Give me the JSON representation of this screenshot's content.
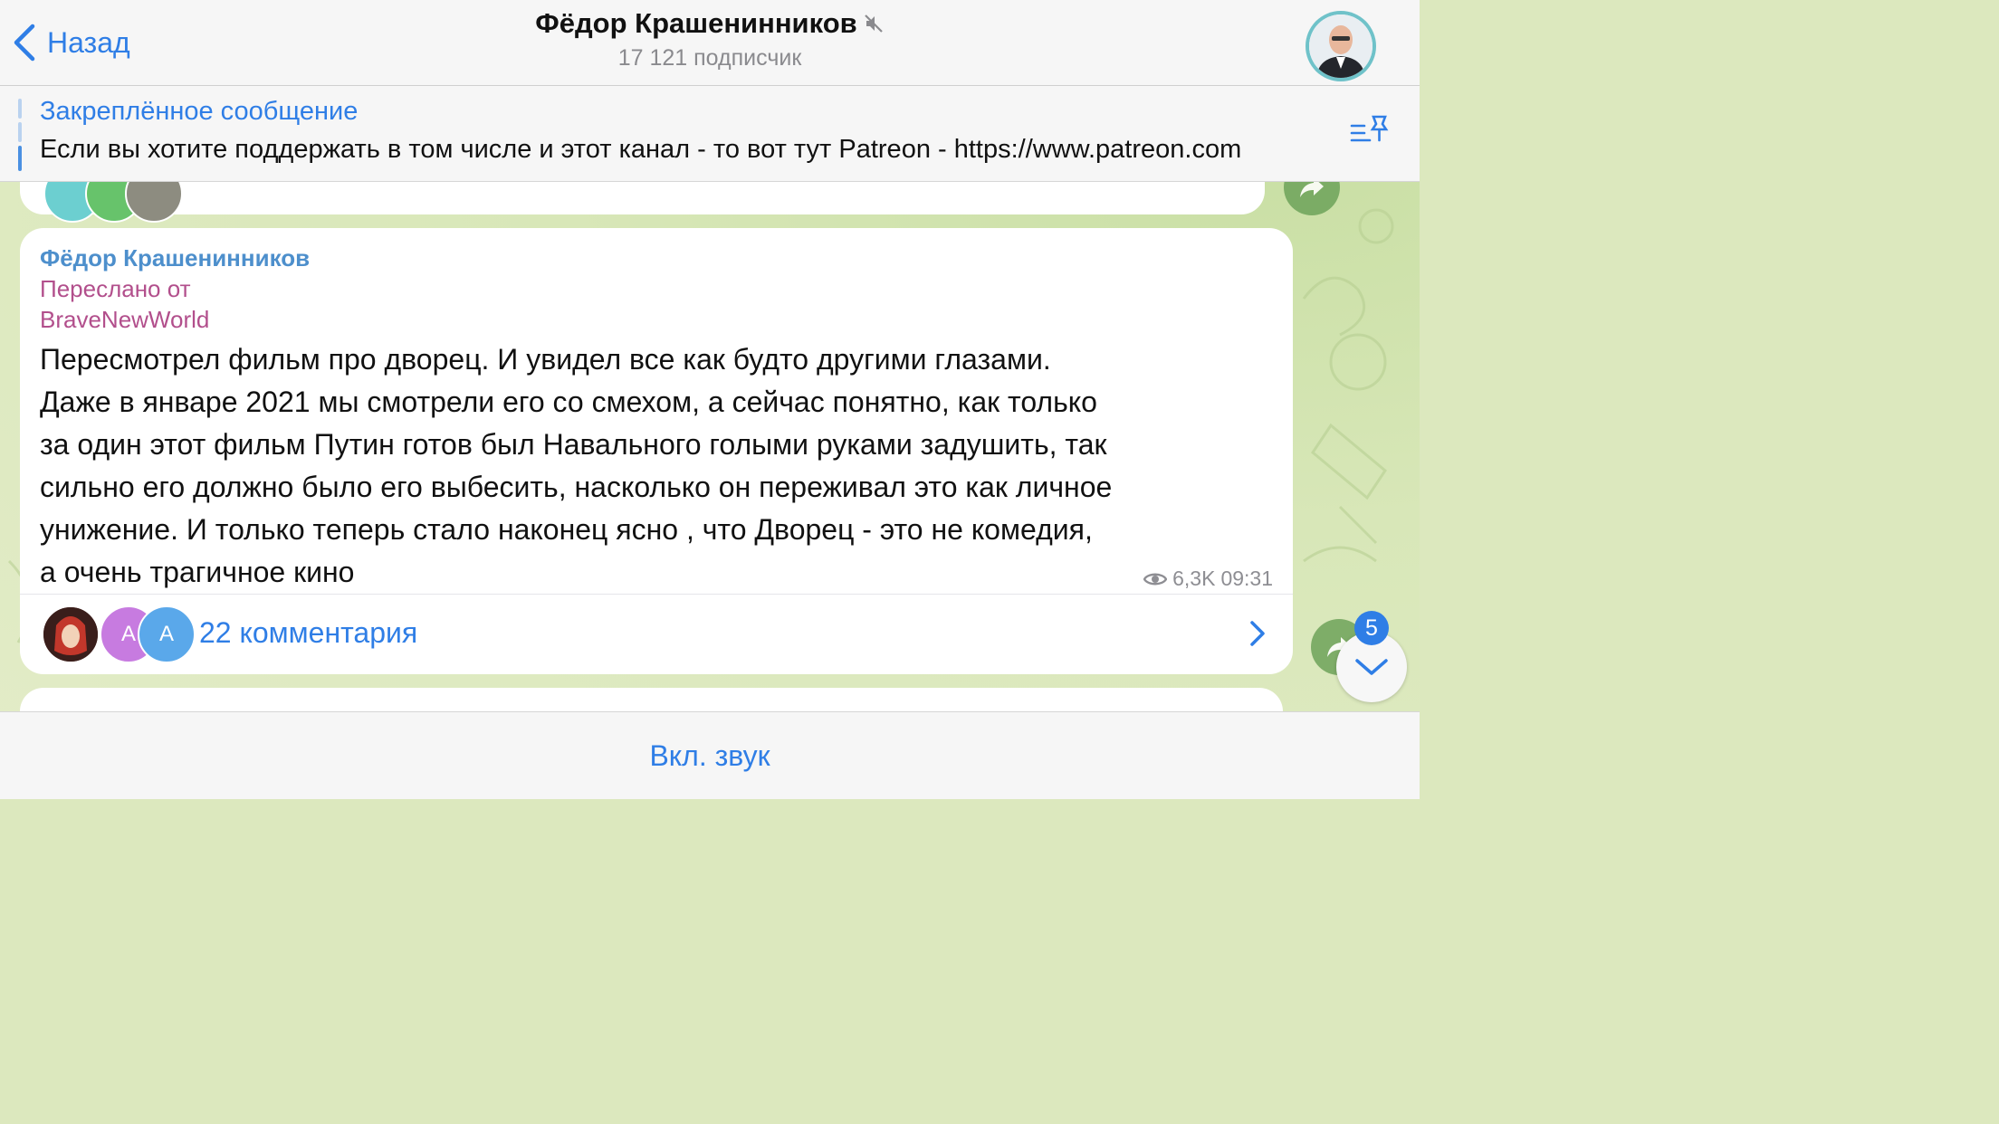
{
  "header": {
    "back_label": "Назад",
    "channel_name": "Фёдор Крашенинников",
    "subscribers": "17 121 подписчик"
  },
  "pinned": {
    "title": "Закреплённое сообщение",
    "text": "Если вы хотите поддержать в том числе и этот канал - то вот тут Patreon - https://www.patreon.com"
  },
  "message": {
    "sender": "Фёдор Крашенинников",
    "forwarded_label": "Переслано от",
    "forwarded_from": "BraveNewWorld",
    "text": "Пересмотрел фильм про дворец. И увидел все как будто другими глазами.\nДаже в январе 2021 мы смотрели его со смехом, а сейчас понятно, как только\nза один этот фильм Путин готов был Навального голыми руками задушить, так\nсильно его должно было его выбесить, насколько он переживал это как личное\nунижение. И только теперь  стало наконец ясно , что Дворец - это не комедия,\nа очень трагичное кино",
    "views": "6,3K",
    "time": "09:31",
    "comments_label": "22 комментария",
    "commenter_avatars": [
      "",
      "A",
      "A"
    ]
  },
  "scroll": {
    "unread_count": "5"
  },
  "bottom": {
    "unmute_label": "Вкл. звук"
  },
  "colors": {
    "accent": "#2f7ee6",
    "forward": "#b24f8c",
    "sender": "#4d8fcc"
  }
}
